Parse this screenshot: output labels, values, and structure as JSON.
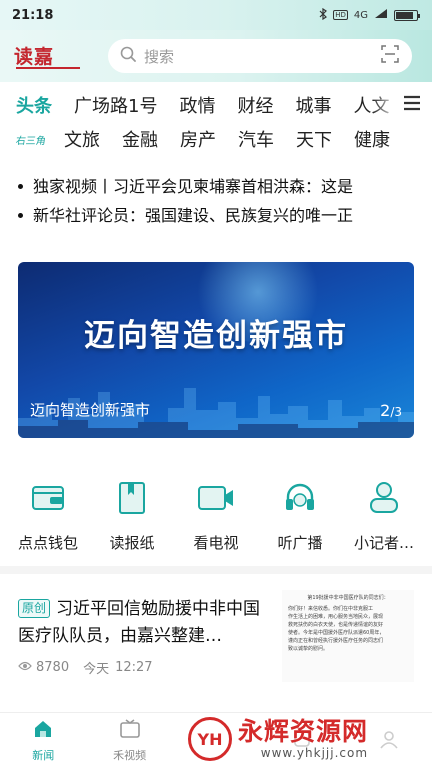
{
  "status_bar": {
    "time": "21:18",
    "network": "4G",
    "hd": "HD"
  },
  "header": {
    "logo_text": "读嘉",
    "search_placeholder": "搜索"
  },
  "tabs_row1": [
    "头条",
    "广场路1号",
    "政情",
    "财经",
    "城事",
    "人文"
  ],
  "tabs_row2_special": "右三角",
  "tabs_row2": [
    "文旅",
    "金融",
    "房产",
    "汽车",
    "天下",
    "健康"
  ],
  "headlines": [
    "独家视频丨习近平会见柬埔寨首相洪森：这是",
    "新华社评论员：强国建设、民族复兴的唯一正"
  ],
  "banner": {
    "title": "迈向智造创新强市",
    "caption": "迈向智造创新强市",
    "page_current": "2",
    "page_total": "/3"
  },
  "quick_links": [
    {
      "label": "点点钱包",
      "icon": "wallet-icon"
    },
    {
      "label": "读报纸",
      "icon": "newspaper-icon"
    },
    {
      "label": "看电视",
      "icon": "tv-camera-icon"
    },
    {
      "label": "听广播",
      "icon": "headphones-icon"
    },
    {
      "label": "小记者…",
      "icon": "reporter-icon"
    }
  ],
  "article": {
    "badge": "原创",
    "title": "习近平回信勉励援中非中国医疗队队员，由嘉兴整建…",
    "views": "8780",
    "date": "今天",
    "time": "12:27",
    "thumb_lines": [
      "第19批援中非中国医疗队的同志们：",
      "你们好！来信收悉。你们在中非克服工",
      "作生活上的困难，用心服务当地民众，展现",
      "救死扶伤的白衣天使，也是传递情谊的友好",
      "使者。今年是中国援外医疗队派遣60周年，",
      "谨向正在和曾经执行援外医疗任务的同志们",
      "致以诚挚的慰问。"
    ]
  },
  "bottom_nav": [
    {
      "label": "新闻",
      "icon": "home-icon"
    },
    {
      "label": "禾视频",
      "icon": "video-icon"
    },
    {
      "label": "",
      "icon": "circle-icon"
    },
    {
      "label": "",
      "icon": "service-icon"
    },
    {
      "label": "",
      "icon": "user-icon"
    }
  ],
  "watermark": {
    "title": "永辉资源网",
    "url": "www.yhkjjj.com",
    "logo_text": "YH"
  },
  "colors": {
    "accent": "#1aa6a0",
    "logo_red": "#c4262e",
    "watermark_red": "#d42a2a"
  }
}
